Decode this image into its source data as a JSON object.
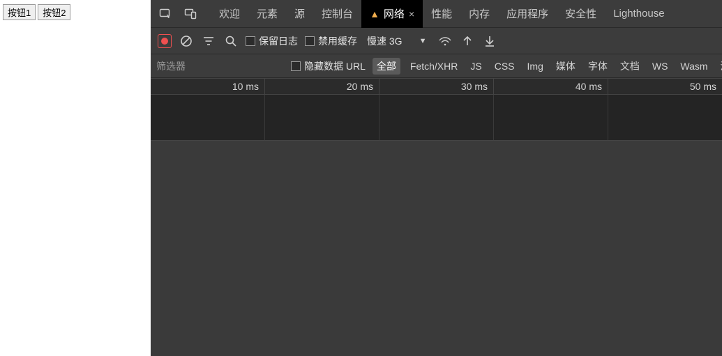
{
  "page": {
    "button1": "按钮1",
    "button2": "按钮2"
  },
  "tabs": {
    "welcome": "欢迎",
    "elements": "元素",
    "sources": "源",
    "console": "控制台",
    "network": "网络",
    "performance": "性能",
    "memory": "内存",
    "application": "应用程序",
    "security": "安全性",
    "lighthouse": "Lighthouse"
  },
  "toolbar": {
    "preserve_log": "保留日志",
    "disable_cache": "禁用缓存",
    "throttling": "慢速 3G"
  },
  "filterbar": {
    "placeholder": "筛选器",
    "hide_data_urls": "隐藏数据 URL",
    "types": {
      "all": "全部",
      "fetch_xhr": "Fetch/XHR",
      "js": "JS",
      "css": "CSS",
      "img": "Img",
      "media": "媒体",
      "font": "字体",
      "doc": "文档",
      "ws": "WS",
      "wasm": "Wasm",
      "manifest": "清单"
    }
  },
  "timeline": {
    "ticks": [
      "10 ms",
      "20 ms",
      "30 ms",
      "40 ms",
      "50 ms"
    ]
  }
}
